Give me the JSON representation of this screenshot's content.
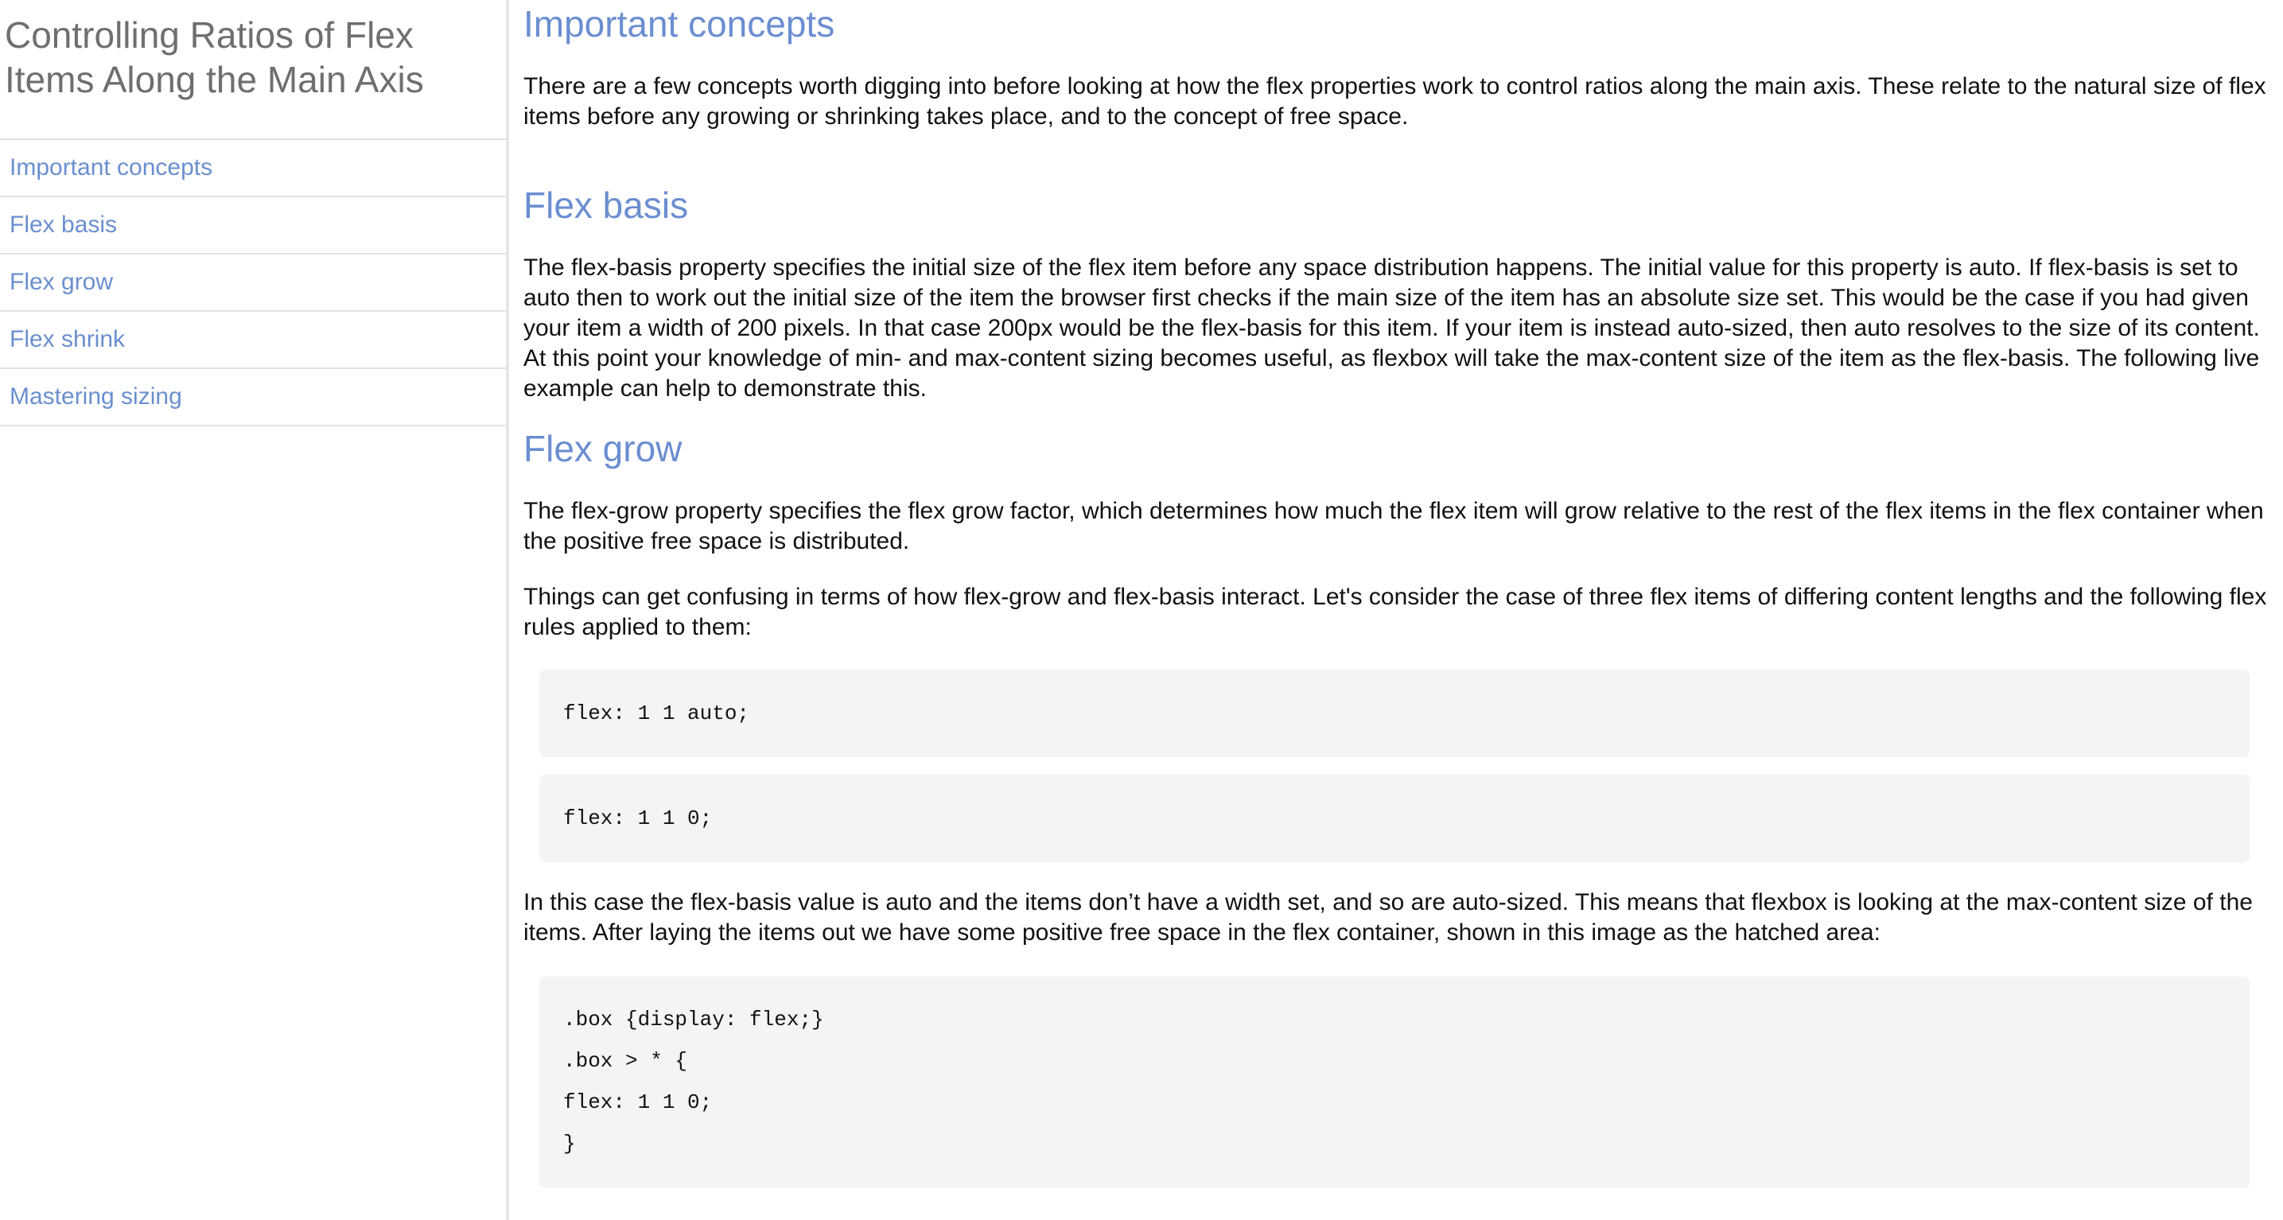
{
  "sidebar": {
    "title": "Controlling Ratios of Flex Items Along the Main Axis",
    "items": [
      {
        "label": "Important concepts"
      },
      {
        "label": "Flex basis"
      },
      {
        "label": "Flex grow"
      },
      {
        "label": "Flex shrink"
      },
      {
        "label": "Mastering sizing"
      }
    ]
  },
  "content": {
    "important": {
      "heading": "Important concepts",
      "paragraph": "There are a few concepts worth digging into before looking at how the flex properties work to control ratios along the main axis. These relate to the natural size of flex items before any growing or shrinking takes place, and to the concept of free space."
    },
    "basis": {
      "heading": "Flex basis",
      "paragraph": "The flex-basis property specifies the initial size of the flex item before any space distribution happens. The initial value for this property is auto. If flex-basis is set to auto then to work out the initial size of the item the browser first checks if the main size of the item has an absolute size set. This would be the case if you had given your item a width of 200 pixels. In that case 200px would be the flex-basis for this item. If your item is instead auto-sized, then auto resolves to the size of its content. At this point your knowledge of min- and max-content sizing becomes useful, as flexbox will take the max-content size of the item as the flex-basis. The following live example can help to demonstrate this."
    },
    "grow": {
      "heading": "Flex grow",
      "paragraph1": "The flex-grow property specifies the flex grow factor, which determines how much the flex item will grow relative to the rest of the flex items in the flex container when the positive free space is distributed.",
      "paragraph2": "Things can get confusing in terms of how flex-grow and flex-basis interact. Let's consider the case of three flex items of differing content lengths and the following flex rules applied to them:",
      "code1": [
        "flex: 1 1 auto;"
      ],
      "code2": [
        "flex: 1 1 0;"
      ],
      "paragraph3": "In this case the flex-basis value is auto and the items don’t have a width set, and so are auto-sized. This means that flexbox is looking at the max-content size of the items. After laying the items out we have some positive free space in the flex container, shown in this image as the hatched area:",
      "code3": [
        ".box {display: flex;}",
        ".box > * {",
        "flex: 1 1 0;",
        "}"
      ]
    }
  }
}
